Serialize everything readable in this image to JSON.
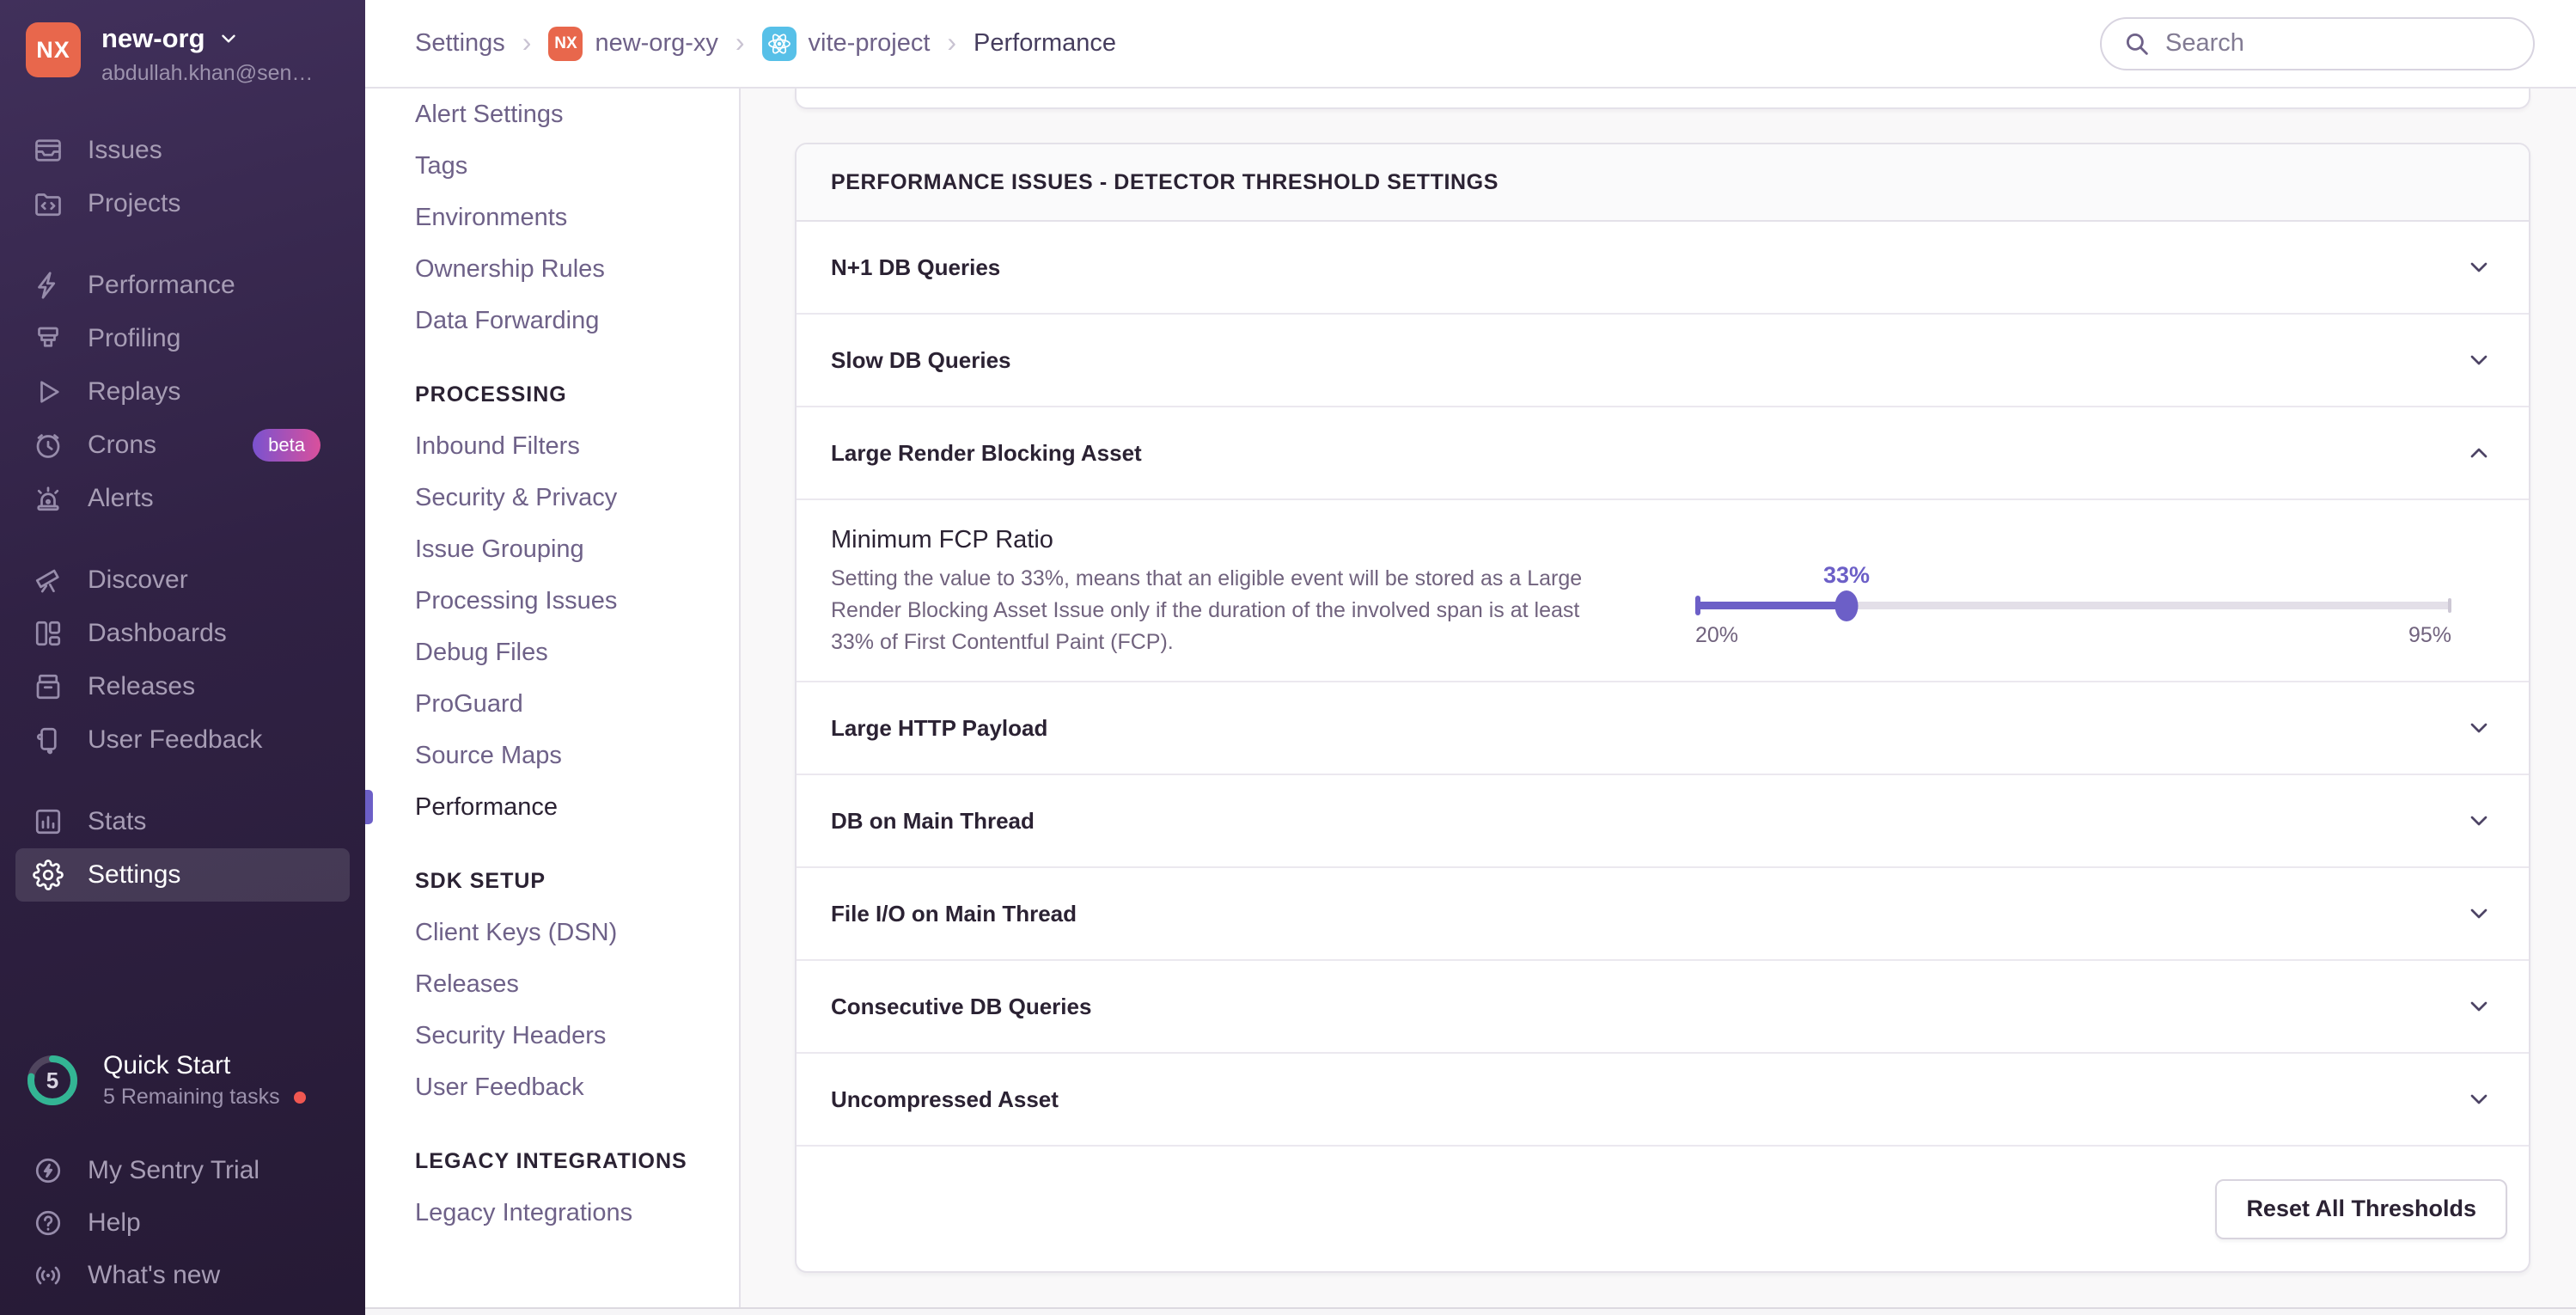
{
  "colors": {
    "accent": "#6c5fc7",
    "org_avatar_orange": "#e8674c",
    "react_badge_blue": "#57c0e8",
    "beta_gradient_start": "#7a52cf",
    "beta_gradient_end": "#d9509c",
    "progress_green": "#33b594",
    "alert_dot_red": "#f05751"
  },
  "sidebar": {
    "org_name": "new-org",
    "org_avatar_initials": "NX",
    "user_email": "abdullah.khan@sen…",
    "groups": [
      [
        {
          "label": "Issues",
          "icon": "issues"
        },
        {
          "label": "Projects",
          "icon": "projects"
        }
      ],
      [
        {
          "label": "Performance",
          "icon": "performance"
        },
        {
          "label": "Profiling",
          "icon": "profiling"
        },
        {
          "label": "Replays",
          "icon": "replays"
        },
        {
          "label": "Crons",
          "icon": "crons",
          "badge": "beta"
        },
        {
          "label": "Alerts",
          "icon": "alerts"
        }
      ],
      [
        {
          "label": "Discover",
          "icon": "discover"
        },
        {
          "label": "Dashboards",
          "icon": "dashboards"
        },
        {
          "label": "Releases",
          "icon": "releases"
        },
        {
          "label": "User Feedback",
          "icon": "user-feedback"
        }
      ],
      [
        {
          "label": "Stats",
          "icon": "stats"
        },
        {
          "label": "Settings",
          "icon": "settings",
          "active": true
        }
      ]
    ],
    "quick_start": {
      "title": "Quick Start",
      "subtitle": "5 Remaining tasks",
      "count": "5"
    },
    "footer_items": [
      {
        "label": "My Sentry Trial",
        "icon": "trial"
      },
      {
        "label": "Help",
        "icon": "help"
      },
      {
        "label": "What's new",
        "icon": "whats-new"
      }
    ]
  },
  "header": {
    "breadcrumbs": [
      {
        "label": "Settings"
      },
      {
        "label": "new-org-xy",
        "badge": "NX"
      },
      {
        "label": "vite-project",
        "badge": "react"
      },
      {
        "label": "Performance"
      }
    ],
    "search_placeholder": "Search"
  },
  "settings_nav": {
    "sections": [
      {
        "heading": null,
        "items": [
          {
            "label": "Alert Settings"
          },
          {
            "label": "Tags"
          },
          {
            "label": "Environments"
          },
          {
            "label": "Ownership Rules"
          },
          {
            "label": "Data Forwarding"
          }
        ]
      },
      {
        "heading": "Processing",
        "items": [
          {
            "label": "Inbound Filters"
          },
          {
            "label": "Security & Privacy"
          },
          {
            "label": "Issue Grouping"
          },
          {
            "label": "Processing Issues"
          },
          {
            "label": "Debug Files"
          },
          {
            "label": "ProGuard"
          },
          {
            "label": "Source Maps"
          },
          {
            "label": "Performance",
            "active": true
          }
        ]
      },
      {
        "heading": "SDK Setup",
        "items": [
          {
            "label": "Client Keys (DSN)"
          },
          {
            "label": "Releases"
          },
          {
            "label": "Security Headers"
          },
          {
            "label": "User Feedback"
          }
        ]
      },
      {
        "heading": "Legacy Integrations",
        "items": [
          {
            "label": "Legacy Integrations"
          }
        ]
      }
    ]
  },
  "main": {
    "panel_title": "PERFORMANCE ISSUES - DETECTOR THRESHOLD SETTINGS",
    "rows": [
      {
        "label": "N+1 DB Queries"
      },
      {
        "label": "Slow DB Queries"
      },
      {
        "label": "Large Render Blocking Asset",
        "expanded": true
      },
      {
        "label": "Large HTTP Payload"
      },
      {
        "label": "DB on Main Thread"
      },
      {
        "label": "File I/O on Main Thread"
      },
      {
        "label": "Consecutive DB Queries"
      },
      {
        "label": "Uncompressed Asset"
      }
    ],
    "detail": {
      "title": "Minimum FCP Ratio",
      "description": "Setting the value to 33%, means that an eligible event will be stored as a Large Render Blocking Asset Issue only if the duration of the involved span is at least 33% of First Contentful Paint (FCP).",
      "slider": {
        "value_label": "33%",
        "min_label": "20%",
        "max_label": "95%",
        "percent": 20
      }
    },
    "reset_button": "Reset All Thresholds"
  }
}
